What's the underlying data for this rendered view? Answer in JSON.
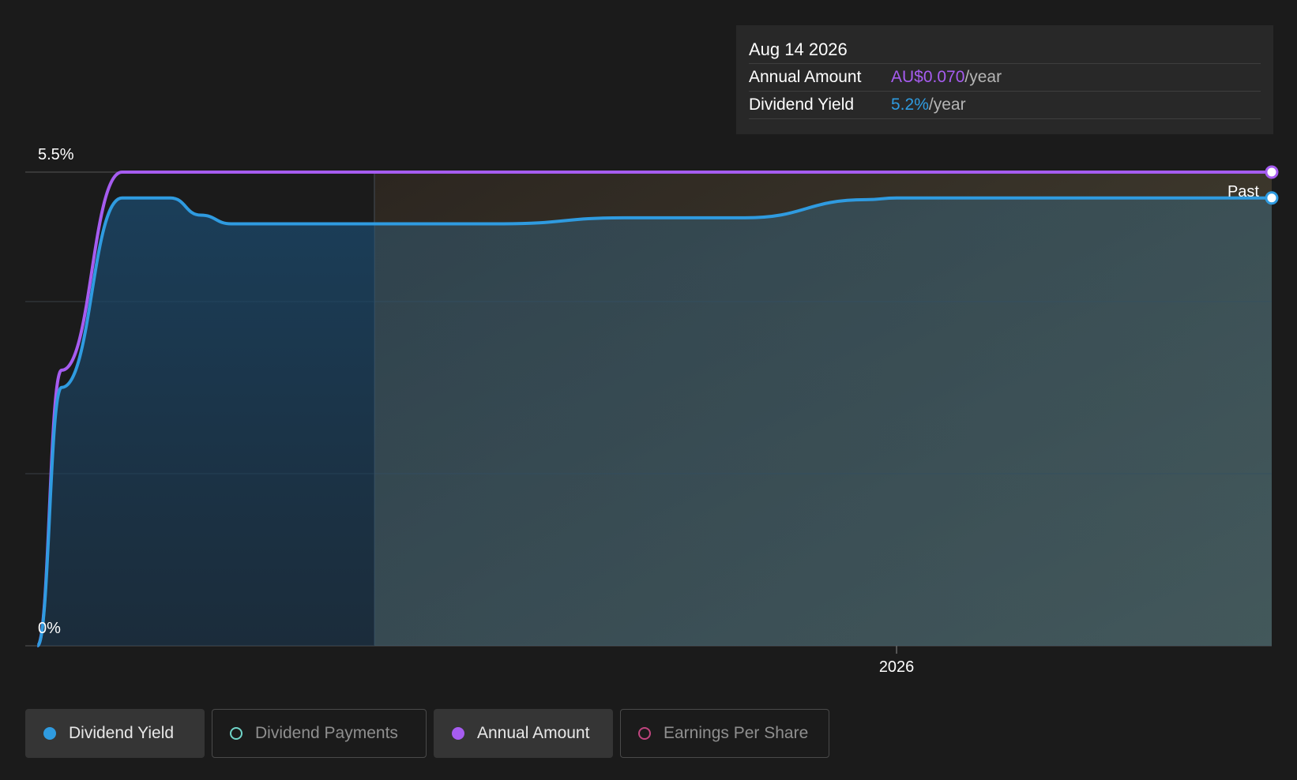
{
  "chart_data": {
    "type": "line",
    "ylim": [
      0,
      5.5
    ],
    "y_ticks": [
      "0%",
      "5.5%"
    ],
    "x_ticks": [
      "2026"
    ],
    "grid": true,
    "forecast_label": "Past",
    "series": [
      {
        "name": "Annual Amount",
        "color": "#a65cf0",
        "x": [
          2024.58,
          2024.62,
          2024.72,
          2024.85,
          2025.2,
          2025.6,
          2026.0,
          2026.3,
          2026.62
        ],
        "y": [
          0,
          3.2,
          5.5,
          5.5,
          5.5,
          5.5,
          5.5,
          5.5,
          5.5
        ]
      },
      {
        "name": "Dividend Yield",
        "color": "#2f9be0",
        "x": [
          2024.58,
          2024.62,
          2024.72,
          2024.8,
          2024.85,
          2024.9,
          2025.2,
          2025.35,
          2025.55,
          2025.75,
          2025.95,
          2026.0,
          2026.1,
          2026.3,
          2026.62
        ],
        "y": [
          0,
          3.0,
          5.2,
          5.2,
          5.0,
          4.9,
          4.9,
          4.9,
          4.97,
          4.97,
          5.18,
          5.2,
          5.2,
          5.2,
          5.2
        ]
      }
    ]
  },
  "tooltip": {
    "date": "Aug 14 2026",
    "rows": [
      {
        "label": "Annual Amount",
        "value": "AU$0.070",
        "unit": "/year"
      },
      {
        "label": "Dividend Yield",
        "value": "5.2%",
        "unit": "/year"
      }
    ]
  },
  "legend": [
    {
      "label": "Dividend Yield",
      "color": "#2f9be0",
      "active": true
    },
    {
      "label": "Dividend Payments",
      "color": "#6fd4c8",
      "active": false
    },
    {
      "label": "Annual Amount",
      "color": "#a65cf0",
      "active": true
    },
    {
      "label": "Earnings Per Share",
      "color": "#c0457f",
      "active": false
    }
  ]
}
